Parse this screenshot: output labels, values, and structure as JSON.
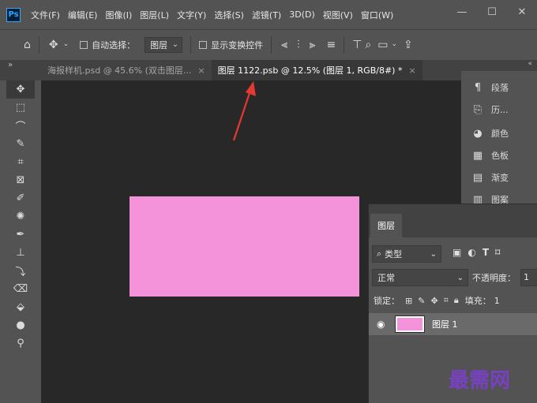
{
  "app": {
    "logo": "Ps"
  },
  "menu": [
    "文件(F)",
    "编辑(E)",
    "图像(I)",
    "图层(L)",
    "文字(Y)",
    "选择(S)",
    "滤镜(T)",
    "3D(D)",
    "视图(V)",
    "窗口(W)"
  ],
  "window_controls": {
    "minimize": "—",
    "maximize": "☐",
    "close": "✕"
  },
  "options_bar": {
    "auto_select_label": "自动选择：",
    "auto_select_value": "图层",
    "show_transform_label": "显示变换控件"
  },
  "tabs": [
    {
      "label": "海报样机.psd @ 45.6% (双击图层...",
      "close": "×",
      "active": false
    },
    {
      "label": "图层 1122.psb @ 12.5% (图层 1, RGB/8#) *",
      "close": "×",
      "active": true
    }
  ],
  "right_panel": [
    {
      "icon": "paragraph-icon",
      "glyph": "¶",
      "label": "段落"
    },
    {
      "icon": "history-icon",
      "glyph": "⎘",
      "label": "历..."
    },
    {
      "icon": "color-icon",
      "glyph": "◕",
      "label": "颜色"
    },
    {
      "icon": "swatches-icon",
      "glyph": "▦",
      "label": "色板"
    },
    {
      "icon": "gradient-icon",
      "glyph": "▤",
      "label": "渐变"
    },
    {
      "icon": "pattern-icon",
      "glyph": "▥",
      "label": "图案"
    }
  ],
  "layers_panel": {
    "tab_label": "图层",
    "filter_label": "类型",
    "blend_mode": "正常",
    "opacity_label": "不透明度：",
    "opacity_value": "1",
    "lock_label": "锁定：",
    "fill_label": "填充：",
    "fill_value": "1",
    "layers": [
      {
        "name": "图层 1",
        "visible": true
      }
    ]
  },
  "canvas": {
    "fill_color": "#f593da",
    "background_color": "#282828"
  },
  "annotation": {
    "arrow_color": "#e53935"
  },
  "watermark": "最需网"
}
